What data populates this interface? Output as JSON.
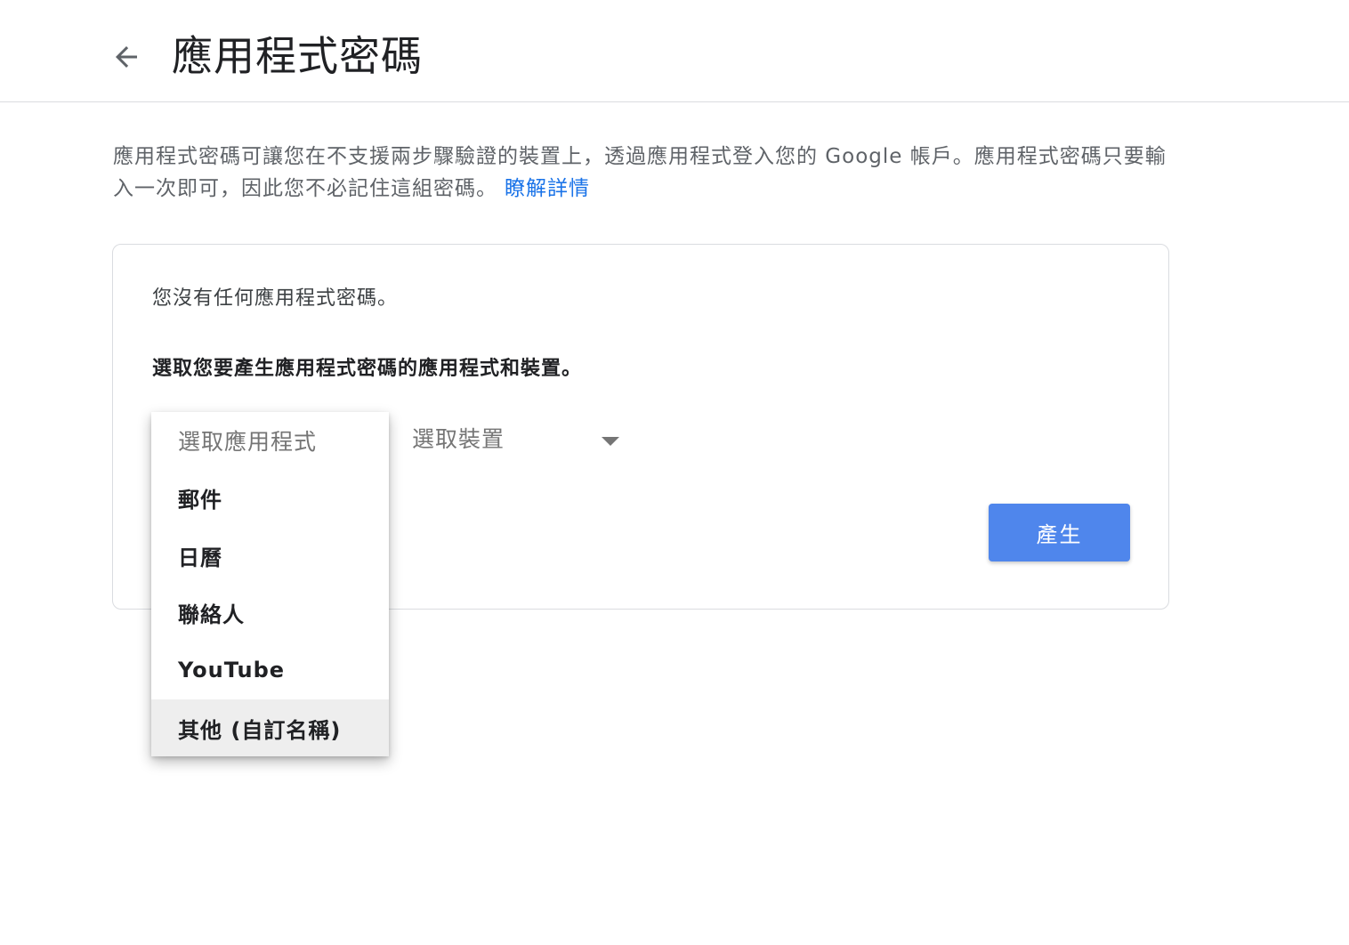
{
  "header": {
    "title": "應用程式密碼"
  },
  "description": {
    "text": "應用程式密碼可讓您在不支援兩步驟驗證的裝置上，透過應用程式登入您的 Google 帳戶。應用程式密碼只要輸入一次即可，因此您不必記住這組密碼。",
    "link_label": "瞭解詳情"
  },
  "card": {
    "empty_text": "您沒有任何應用程式密碼。",
    "select_prompt": "選取您要產生應用程式密碼的應用程式和裝置。",
    "device_select_label": "選取裝置",
    "generate_label": "產生"
  },
  "app_menu": {
    "placeholder": "選取應用程式",
    "items": [
      {
        "label": "郵件"
      },
      {
        "label": "日曆"
      },
      {
        "label": "聯絡人"
      },
      {
        "label": "YouTube"
      },
      {
        "label": "其他 (自訂名稱)"
      }
    ],
    "highlighted_index": 4
  },
  "colors": {
    "accent": "#4f86ec",
    "link": "#1a73e8",
    "text_primary": "#202124",
    "text_secondary": "#5f6368",
    "border": "#dadce0"
  },
  "icons": {
    "back": "arrow-back-icon",
    "dropdown": "caret-down-icon"
  }
}
